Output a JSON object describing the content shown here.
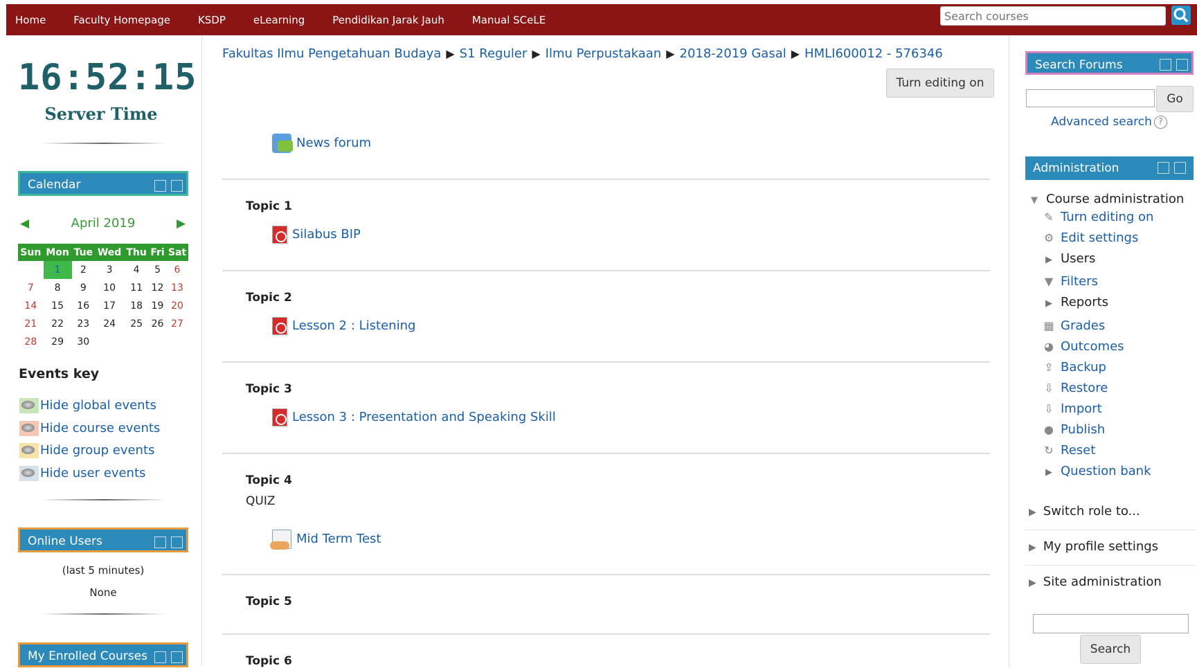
{
  "nav": {
    "items": [
      "Home",
      "Faculty Homepage",
      "KSDP",
      "eLearning",
      "Pendidikan Jarak Jauh",
      "Manual SCeLE"
    ],
    "search_placeholder": "Search courses"
  },
  "clock": {
    "time": "16:52:15",
    "label": "Server Time"
  },
  "calendar": {
    "title": "Calendar",
    "month": "April 2019",
    "prev": "◀",
    "next": "▶",
    "days": [
      "Sun",
      "Mon",
      "Tue",
      "Wed",
      "Thu",
      "Fri",
      "Sat"
    ],
    "weeks": [
      [
        "",
        "1",
        "2",
        "3",
        "4",
        "5",
        "6"
      ],
      [
        "7",
        "8",
        "9",
        "10",
        "11",
        "12",
        "13"
      ],
      [
        "14",
        "15",
        "16",
        "17",
        "18",
        "19",
        "20"
      ],
      [
        "21",
        "22",
        "23",
        "24",
        "25",
        "26",
        "27"
      ],
      [
        "28",
        "29",
        "30",
        "",
        "",
        "",
        ""
      ]
    ],
    "today": "1"
  },
  "events_key": {
    "title": "Events key",
    "items": [
      {
        "label": "Hide global events",
        "color": "#c8e6b8"
      },
      {
        "label": "Hide course events",
        "color": "#f5c8b5"
      },
      {
        "label": "Hide group events",
        "color": "#f7e2a8"
      },
      {
        "label": "Hide user events",
        "color": "#d5e2ea"
      }
    ]
  },
  "online_users": {
    "title": "Online Users",
    "subtitle": "(last 5 minutes)",
    "value": "None"
  },
  "enrolled": {
    "title": "My Enrolled Courses"
  },
  "breadcrumb": {
    "items": [
      "Fakultas Ilmu Pengetahuan Budaya",
      "S1 Reguler",
      "Ilmu Perpustakaan",
      "2018-2019 Gasal",
      "HMLI600012 - 576346"
    ],
    "separator": "▶"
  },
  "main": {
    "turn_editing": "Turn editing on",
    "news_forum": "News forum",
    "topics": [
      {
        "title": "Topic 1",
        "activity": "Silabus BIP"
      },
      {
        "title": "Topic 2",
        "activity": "Lesson 2 : Listening"
      },
      {
        "title": "Topic 3",
        "activity": "Lesson 3 : Presentation and Speaking Skill"
      },
      {
        "title": "Topic 4",
        "summary": "QUIZ",
        "activity": "Mid Term Test"
      },
      {
        "title": "Topic 5"
      },
      {
        "title": "Topic 6"
      }
    ]
  },
  "search_forums": {
    "title": "Search Forums",
    "go": "Go",
    "advanced": "Advanced search",
    "help": "?"
  },
  "administration": {
    "title": "Administration",
    "course_admin": "Course administration",
    "items": [
      {
        "label": "Turn editing on",
        "icon": "pencil-icon",
        "link": true
      },
      {
        "label": "Edit settings",
        "icon": "gear-icon",
        "link": true
      },
      {
        "label": "Users",
        "icon": "expand-arrow-icon",
        "link": false
      },
      {
        "label": "Filters",
        "icon": "filter-icon",
        "link": true
      },
      {
        "label": "Reports",
        "icon": "expand-arrow-icon",
        "link": false
      },
      {
        "label": "Grades",
        "icon": "grades-icon",
        "link": true
      },
      {
        "label": "Outcomes",
        "icon": "outcomes-icon",
        "link": true
      },
      {
        "label": "Backup",
        "icon": "backup-icon",
        "link": true
      },
      {
        "label": "Restore",
        "icon": "restore-icon",
        "link": true
      },
      {
        "label": "Import",
        "icon": "import-icon",
        "link": true
      },
      {
        "label": "Publish",
        "icon": "publish-icon",
        "link": true
      },
      {
        "label": "Reset",
        "icon": "reset-icon",
        "link": true
      },
      {
        "label": "Question bank",
        "icon": "expand-arrow-icon",
        "link": true
      }
    ],
    "groups": [
      "Switch role to...",
      "My profile settings",
      "Site administration"
    ],
    "search_button": "Search"
  }
}
